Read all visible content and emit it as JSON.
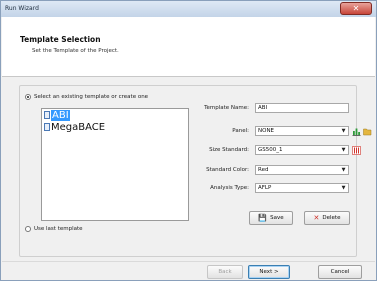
{
  "window": {
    "title": "Run Wizard",
    "close_glyph": "✕"
  },
  "header": {
    "title": "Template Selection",
    "subtitle": "Set the Template of the Project."
  },
  "template_source": {
    "existing_label": "Select an existing template or create one",
    "existing_checked": true,
    "last_label": "Use last template",
    "last_checked": false
  },
  "templates": [
    {
      "name": "ABI",
      "selected": true
    },
    {
      "name": "MegaBACE",
      "selected": false
    }
  ],
  "form": {
    "template_name_label": "Template Name:",
    "template_name_value": "ABI",
    "panel_label": "Panel:",
    "panel_value": "NONE",
    "size_standard_label": "Size Standard:",
    "size_standard_value": "GS500_1",
    "standard_color_label": "Standard Color:",
    "standard_color_value": "Red",
    "analysis_type_label": "Analysis Type:",
    "analysis_type_value": "AFLP"
  },
  "actions": {
    "save_label": "Save",
    "delete_label": "Delete"
  },
  "nav": {
    "back_label": "Back",
    "next_label": "Next >",
    "cancel_label": "Cancel"
  },
  "colors": {
    "selection": "#3399ff",
    "close": "#c7463a",
    "chart_icon": "#2f9a3a",
    "ladder_icon": "#d0342c"
  },
  "icons": {
    "panel_tool_1": "bar-chart-icon",
    "panel_tool_2": "open-folder-icon",
    "size_standard_tool": "ladder-icon",
    "save_button_icon": "floppy-disk-icon",
    "delete_button_icon": "red-x-icon"
  }
}
